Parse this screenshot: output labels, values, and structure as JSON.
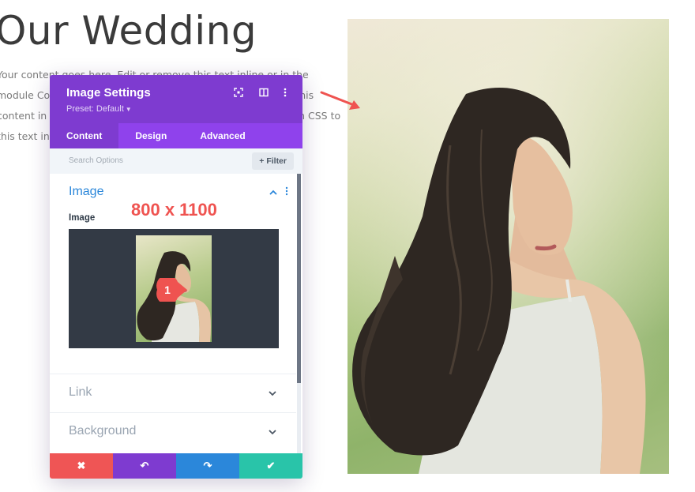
{
  "page": {
    "title": "Our Wedding",
    "body_lines": [
      "Your content goes here. Edit or remove this text inline or in the",
      "module Content settings. You can also style every aspect of this",
      "content in the module Design settings and even apply custom CSS to",
      "this text in the module Advanced settings."
    ]
  },
  "annotation": {
    "dimensions": "800 x 1100",
    "step_number": "1",
    "color": "#ef5350"
  },
  "modal": {
    "title": "Image Settings",
    "preset": "Preset: Default",
    "header_icons": [
      "focus-icon",
      "split-view-icon",
      "more-icon"
    ],
    "tabs": [
      {
        "label": "Content",
        "active": true
      },
      {
        "label": "Design",
        "active": false
      },
      {
        "label": "Advanced",
        "active": false
      }
    ],
    "search_placeholder": "Search Options",
    "filter_label": "+ Filter",
    "image_section": {
      "title": "Image",
      "field_label": "Image"
    },
    "link_section": {
      "title": "Link"
    },
    "background_section": {
      "title": "Background"
    },
    "footer": [
      {
        "name": "cancel",
        "glyph": "✖",
        "color": "#ef5555"
      },
      {
        "name": "undo",
        "glyph": "↶",
        "color": "#7e3bd0"
      },
      {
        "name": "redo",
        "glyph": "↷",
        "color": "#2b87da"
      },
      {
        "name": "save",
        "glyph": "✔",
        "color": "#29c4a9"
      }
    ],
    "colors": {
      "header": "#7e3bd0",
      "tabs": "#8f42ec",
      "accent": "#2b87da"
    }
  }
}
